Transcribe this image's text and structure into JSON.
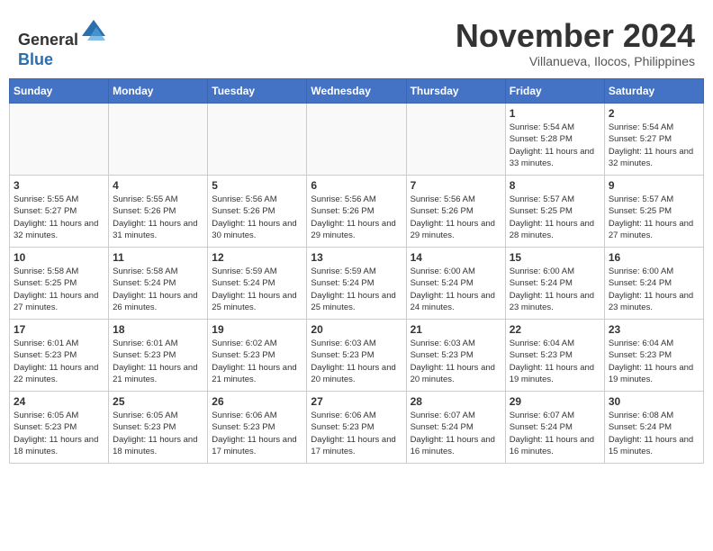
{
  "header": {
    "logo_line1": "General",
    "logo_line2": "Blue",
    "month": "November 2024",
    "location": "Villanueva, Ilocos, Philippines"
  },
  "weekdays": [
    "Sunday",
    "Monday",
    "Tuesday",
    "Wednesday",
    "Thursday",
    "Friday",
    "Saturday"
  ],
  "weeks": [
    [
      {
        "day": "",
        "info": ""
      },
      {
        "day": "",
        "info": ""
      },
      {
        "day": "",
        "info": ""
      },
      {
        "day": "",
        "info": ""
      },
      {
        "day": "",
        "info": ""
      },
      {
        "day": "1",
        "info": "Sunrise: 5:54 AM\nSunset: 5:28 PM\nDaylight: 11 hours and 33 minutes."
      },
      {
        "day": "2",
        "info": "Sunrise: 5:54 AM\nSunset: 5:27 PM\nDaylight: 11 hours and 32 minutes."
      }
    ],
    [
      {
        "day": "3",
        "info": "Sunrise: 5:55 AM\nSunset: 5:27 PM\nDaylight: 11 hours and 32 minutes."
      },
      {
        "day": "4",
        "info": "Sunrise: 5:55 AM\nSunset: 5:26 PM\nDaylight: 11 hours and 31 minutes."
      },
      {
        "day": "5",
        "info": "Sunrise: 5:56 AM\nSunset: 5:26 PM\nDaylight: 11 hours and 30 minutes."
      },
      {
        "day": "6",
        "info": "Sunrise: 5:56 AM\nSunset: 5:26 PM\nDaylight: 11 hours and 29 minutes."
      },
      {
        "day": "7",
        "info": "Sunrise: 5:56 AM\nSunset: 5:26 PM\nDaylight: 11 hours and 29 minutes."
      },
      {
        "day": "8",
        "info": "Sunrise: 5:57 AM\nSunset: 5:25 PM\nDaylight: 11 hours and 28 minutes."
      },
      {
        "day": "9",
        "info": "Sunrise: 5:57 AM\nSunset: 5:25 PM\nDaylight: 11 hours and 27 minutes."
      }
    ],
    [
      {
        "day": "10",
        "info": "Sunrise: 5:58 AM\nSunset: 5:25 PM\nDaylight: 11 hours and 27 minutes."
      },
      {
        "day": "11",
        "info": "Sunrise: 5:58 AM\nSunset: 5:24 PM\nDaylight: 11 hours and 26 minutes."
      },
      {
        "day": "12",
        "info": "Sunrise: 5:59 AM\nSunset: 5:24 PM\nDaylight: 11 hours and 25 minutes."
      },
      {
        "day": "13",
        "info": "Sunrise: 5:59 AM\nSunset: 5:24 PM\nDaylight: 11 hours and 25 minutes."
      },
      {
        "day": "14",
        "info": "Sunrise: 6:00 AM\nSunset: 5:24 PM\nDaylight: 11 hours and 24 minutes."
      },
      {
        "day": "15",
        "info": "Sunrise: 6:00 AM\nSunset: 5:24 PM\nDaylight: 11 hours and 23 minutes."
      },
      {
        "day": "16",
        "info": "Sunrise: 6:00 AM\nSunset: 5:24 PM\nDaylight: 11 hours and 23 minutes."
      }
    ],
    [
      {
        "day": "17",
        "info": "Sunrise: 6:01 AM\nSunset: 5:23 PM\nDaylight: 11 hours and 22 minutes."
      },
      {
        "day": "18",
        "info": "Sunrise: 6:01 AM\nSunset: 5:23 PM\nDaylight: 11 hours and 21 minutes."
      },
      {
        "day": "19",
        "info": "Sunrise: 6:02 AM\nSunset: 5:23 PM\nDaylight: 11 hours and 21 minutes."
      },
      {
        "day": "20",
        "info": "Sunrise: 6:03 AM\nSunset: 5:23 PM\nDaylight: 11 hours and 20 minutes."
      },
      {
        "day": "21",
        "info": "Sunrise: 6:03 AM\nSunset: 5:23 PM\nDaylight: 11 hours and 20 minutes."
      },
      {
        "day": "22",
        "info": "Sunrise: 6:04 AM\nSunset: 5:23 PM\nDaylight: 11 hours and 19 minutes."
      },
      {
        "day": "23",
        "info": "Sunrise: 6:04 AM\nSunset: 5:23 PM\nDaylight: 11 hours and 19 minutes."
      }
    ],
    [
      {
        "day": "24",
        "info": "Sunrise: 6:05 AM\nSunset: 5:23 PM\nDaylight: 11 hours and 18 minutes."
      },
      {
        "day": "25",
        "info": "Sunrise: 6:05 AM\nSunset: 5:23 PM\nDaylight: 11 hours and 18 minutes."
      },
      {
        "day": "26",
        "info": "Sunrise: 6:06 AM\nSunset: 5:23 PM\nDaylight: 11 hours and 17 minutes."
      },
      {
        "day": "27",
        "info": "Sunrise: 6:06 AM\nSunset: 5:23 PM\nDaylight: 11 hours and 17 minutes."
      },
      {
        "day": "28",
        "info": "Sunrise: 6:07 AM\nSunset: 5:24 PM\nDaylight: 11 hours and 16 minutes."
      },
      {
        "day": "29",
        "info": "Sunrise: 6:07 AM\nSunset: 5:24 PM\nDaylight: 11 hours and 16 minutes."
      },
      {
        "day": "30",
        "info": "Sunrise: 6:08 AM\nSunset: 5:24 PM\nDaylight: 11 hours and 15 minutes."
      }
    ]
  ]
}
